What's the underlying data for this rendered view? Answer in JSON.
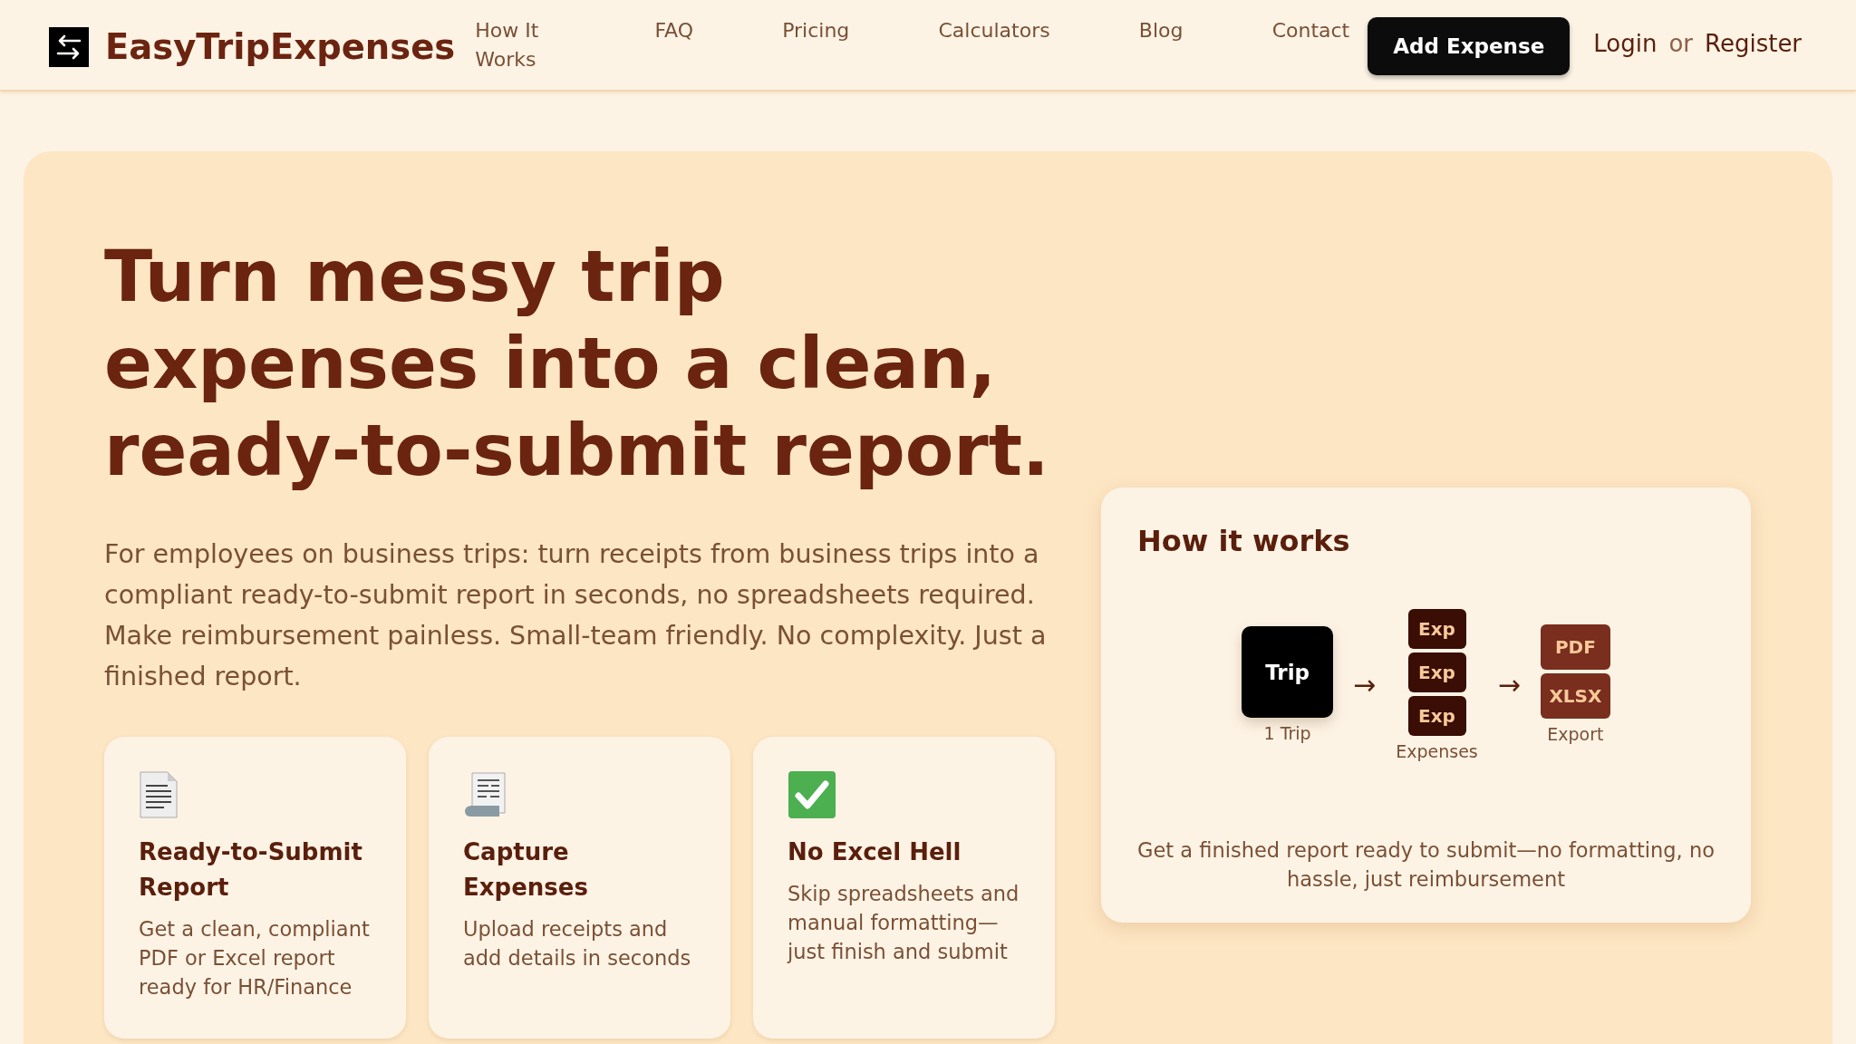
{
  "header": {
    "brand": "EasyTripExpenses",
    "nav": [
      "How It Works",
      "FAQ",
      "Pricing",
      "Calculators",
      "Blog",
      "Contact"
    ],
    "cta": "Add Expense",
    "login": "Login",
    "or": "or",
    "register": "Register"
  },
  "hero": {
    "headline": "Turn messy trip expenses into a clean, ready-to-submit report.",
    "intro": "For employees on business trips: turn receipts from business trips into a compliant ready-to-submit report in seconds, no spreadsheets required. Make reimbursement painless. Small-team friendly. No complexity. Just a finished report.",
    "features": [
      {
        "kind": "document",
        "title": "Ready-to-Submit Report",
        "text": "Get a clean, compliant PDF or Excel report ready for HR/Finance"
      },
      {
        "kind": "receipt",
        "title": "Capture Expenses",
        "text": "Upload receipts and add details in seconds"
      },
      {
        "kind": "check",
        "title": "No Excel Hell",
        "text": "Skip spreadsheets and manual formatting—just finish and submit"
      }
    ]
  },
  "how_it_works": {
    "title": "How it works",
    "steps": [
      {
        "kind": "trip",
        "tiles": [
          "Trip"
        ],
        "caption": "1 Trip"
      },
      {
        "kind": "expenses",
        "arrow_before": "→",
        "tiles": [
          "Exp",
          "Exp",
          "Exp"
        ],
        "caption": "Expenses"
      },
      {
        "kind": "export",
        "arrow_before": "→",
        "tiles": [
          "PDF",
          "XLSX"
        ],
        "caption": "Export"
      }
    ],
    "summary": "Get a finished report ready to submit—no formatting, no hassle, just reimbursement"
  }
}
